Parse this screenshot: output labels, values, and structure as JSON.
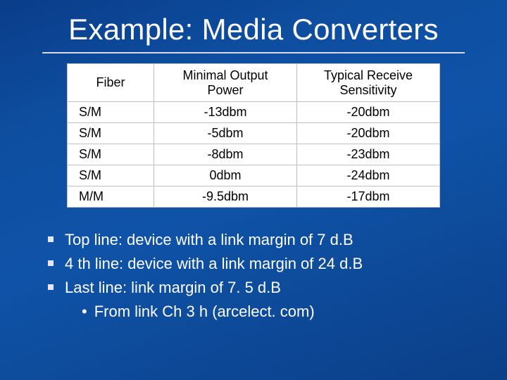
{
  "title": "Example: Media Converters",
  "table": {
    "headers": [
      "Fiber",
      "Minimal Output Power",
      "Typical Receive Sensitivity"
    ],
    "rows": [
      {
        "fiber": "S/M",
        "out": "-13dbm",
        "sens": "-20dbm"
      },
      {
        "fiber": "S/M",
        "out": "-5dbm",
        "sens": "-20dbm"
      },
      {
        "fiber": "S/M",
        "out": "-8dbm",
        "sens": "-23dbm"
      },
      {
        "fiber": "S/M",
        "out": "0dbm",
        "sens": "-24dbm"
      },
      {
        "fiber": "M/M",
        "out": "-9.5dbm",
        "sens": "-17dbm"
      }
    ]
  },
  "bullets": [
    "Top line: device with a link margin of 7 d.B",
    "4 th line: device with a link margin of 24 d.B",
    "Last line: link margin of 7. 5 d.B"
  ],
  "sub_bullet": "From link Ch 3 h (arcelect. com)"
}
